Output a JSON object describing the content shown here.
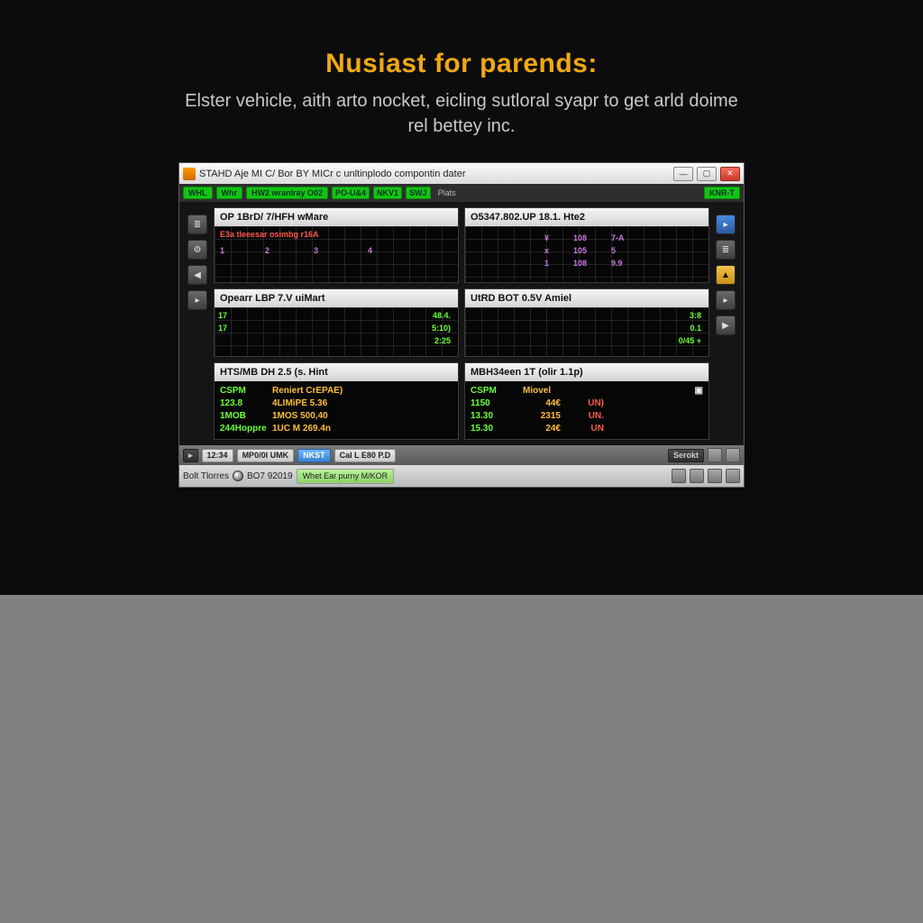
{
  "headline": "Nusiast for parends:",
  "subtext": "Elster vehicle, aith arto nocket, eicling sutloral syapr to get arld doime rel bettey inc.",
  "window": {
    "title": "STAHD Aje MI C/ Bor BY MICr c unltinplodo compontin dater",
    "toolbar_chips": [
      "WHL",
      "Whr",
      "HW2 wranlray O02",
      "PO-U&4",
      "NKV1",
      "SWJ"
    ],
    "toolbar_label": "Plats",
    "toolbar_right": "KNR-T",
    "left_icons": [
      "bar-icon",
      "gear-icon",
      "left-arrow-icon",
      "tag-icon"
    ],
    "right_icons": [
      "tag-blue-icon",
      "list-icon",
      "warn-icon",
      "tag-icon",
      "right-arrow-icon"
    ],
    "panel1": {
      "title": "OP   1BrD/ 7/HFH  wMare",
      "err": "E3a tleeesar  osimbg r16A",
      "ticks": [
        "1",
        "2",
        "3",
        "4"
      ]
    },
    "panel2": {
      "title": "O5347.802.UP 18.1. Hte2",
      "rows": [
        {
          "a": "¥",
          "b": "108",
          "c": "7-A"
        },
        {
          "a": "x",
          "b": "105",
          "c": "5"
        },
        {
          "a": "1",
          "b": "108",
          "c": "9.9"
        }
      ]
    },
    "panel3": {
      "title": "Opearr    LBP 7.V uiMart",
      "vals": [
        "48.4.",
        "5:10)",
        "2:25"
      ],
      "left": [
        "17",
        "17"
      ]
    },
    "panel4": {
      "title": "UtRD BOT 0.5V   Amiel",
      "vals": [
        "3:8",
        "0.1",
        "0/45 +"
      ]
    },
    "panel5": {
      "title": "HTS/MB DH 2.5 (s.  Hint",
      "rows": [
        {
          "a": "CSPM",
          "b": "Reniert  CrEPAE)",
          "c": ""
        },
        {
          "a": "123.8",
          "b": "4LIMiPE  5.36",
          "c": ""
        },
        {
          "a": "1MOB",
          "b": "1MOS 500,40",
          "c": ""
        },
        {
          "a": "244Hoppre",
          "b": "1UC M 269.4n",
          "c": ""
        }
      ]
    },
    "panel6": {
      "title": "MBH34een 1T  (olir 1.1p)",
      "rows": [
        {
          "a": "CSPM",
          "b": "Miovel",
          "c": ""
        },
        {
          "a": "1150",
          "b": "44€",
          "c": "UN)"
        },
        {
          "a": "13.30",
          "b": "2315",
          "c": "UN."
        },
        {
          "a": "15.30",
          "b": "24€",
          "c": "UN"
        }
      ]
    },
    "status": {
      "left1": "12:34",
      "left2": "MP0/0I UMK",
      "blue": "NKST",
      "mid": "Cal L  E80 P.D",
      "right": "Serokt"
    },
    "taskbar": {
      "left": "Bolt Tlorres",
      "rec": "BO7 92019",
      "active": "Whet Ear purny M/KOR"
    }
  }
}
